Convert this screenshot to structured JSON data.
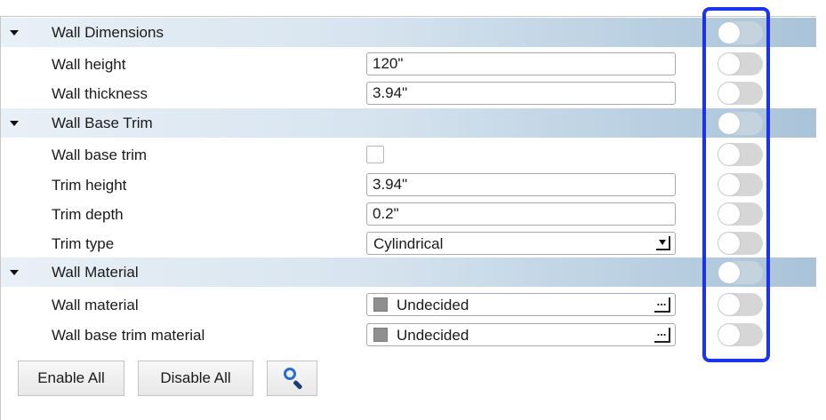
{
  "sections": [
    {
      "title": "Wall Dimensions",
      "rows": [
        {
          "label": "Wall height",
          "type": "text",
          "value": "120\""
        },
        {
          "label": "Wall thickness",
          "type": "text",
          "value": "3.94\""
        }
      ]
    },
    {
      "title": "Wall Base Trim",
      "rows": [
        {
          "label": "Wall base trim",
          "type": "checkbox",
          "checked": false
        },
        {
          "label": "Trim height",
          "type": "text",
          "value": "3.94\""
        },
        {
          "label": "Trim depth",
          "type": "text",
          "value": "0.2\""
        },
        {
          "label": "Trim type",
          "type": "select",
          "value": "Cylindrical"
        }
      ]
    },
    {
      "title": "Wall Material",
      "rows": [
        {
          "label": "Wall material",
          "type": "material",
          "value": "Undecided"
        },
        {
          "label": "Wall base trim material",
          "type": "material",
          "value": "Undecided"
        }
      ]
    }
  ],
  "toggles": {
    "state": "off"
  },
  "buttons": {
    "enable_all": "Enable All",
    "disable_all": "Disable All",
    "search_icon": "search-icon"
  },
  "colors": {
    "highlight": "#1b33ee",
    "section_header_start": "#e9f0f7",
    "section_header_end": "#a9c3d8",
    "toggle_off": "#d6d6d6",
    "swatch": "#8f8f8f"
  }
}
